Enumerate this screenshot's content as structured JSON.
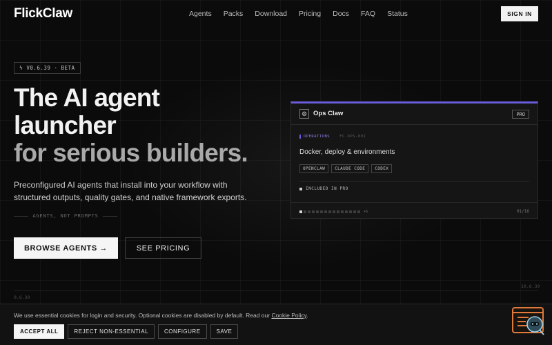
{
  "brand": {
    "name": "FlickClaw"
  },
  "nav": {
    "items": [
      "Agents",
      "Packs",
      "Download",
      "Pricing",
      "Docs",
      "FAQ",
      "Status"
    ],
    "signin_label": "SIGN IN"
  },
  "badge": {
    "icon": "bolt-icon",
    "label": "V0.6.39 · BETA"
  },
  "hero": {
    "line1": "The AI agent",
    "line2": "launcher",
    "line3": "for serious builders.",
    "subtitle": "Preconfigured AI agents that install into your workflow with structured outputs, quality gates, and native framework exports.",
    "tagline": "AGENTS, NOT PROMPTS",
    "primary_cta": "BROWSE AGENTS →",
    "secondary_cta": "SEE PRICING"
  },
  "card": {
    "icon": "gear-icon",
    "name": "Ops Claw",
    "tier": "PRO",
    "category": "OPERATIONS",
    "code": "FC-OPS-001",
    "description": "Docker, deploy & environments",
    "chips": [
      "OPENCLAW",
      "CLAUDE CODE",
      "CODEX"
    ],
    "included": "INCLUDED IN PRO",
    "pager_more": "+6",
    "pager_count": "01/16",
    "pager_current": 1,
    "pager_dots_visible": 15,
    "accent_color": "#6a5cd8"
  },
  "footer": {
    "version_left": "0.6.39",
    "version_right": "10.6.39"
  },
  "cookie": {
    "text_prefix": "We use essential cookies for login and security. Optional cookies are disabled by default. Read our ",
    "link_label": "Cookie Policy",
    "text_suffix": ".",
    "buttons": {
      "accept": "ACCEPT ALL",
      "reject": "REJECT NON-ESSENTIAL",
      "configure": "CONFIGURE",
      "save": "SAVE"
    }
  },
  "widget": {
    "icon": "chat-helper-icon",
    "accent_color": "#e07a3a"
  }
}
